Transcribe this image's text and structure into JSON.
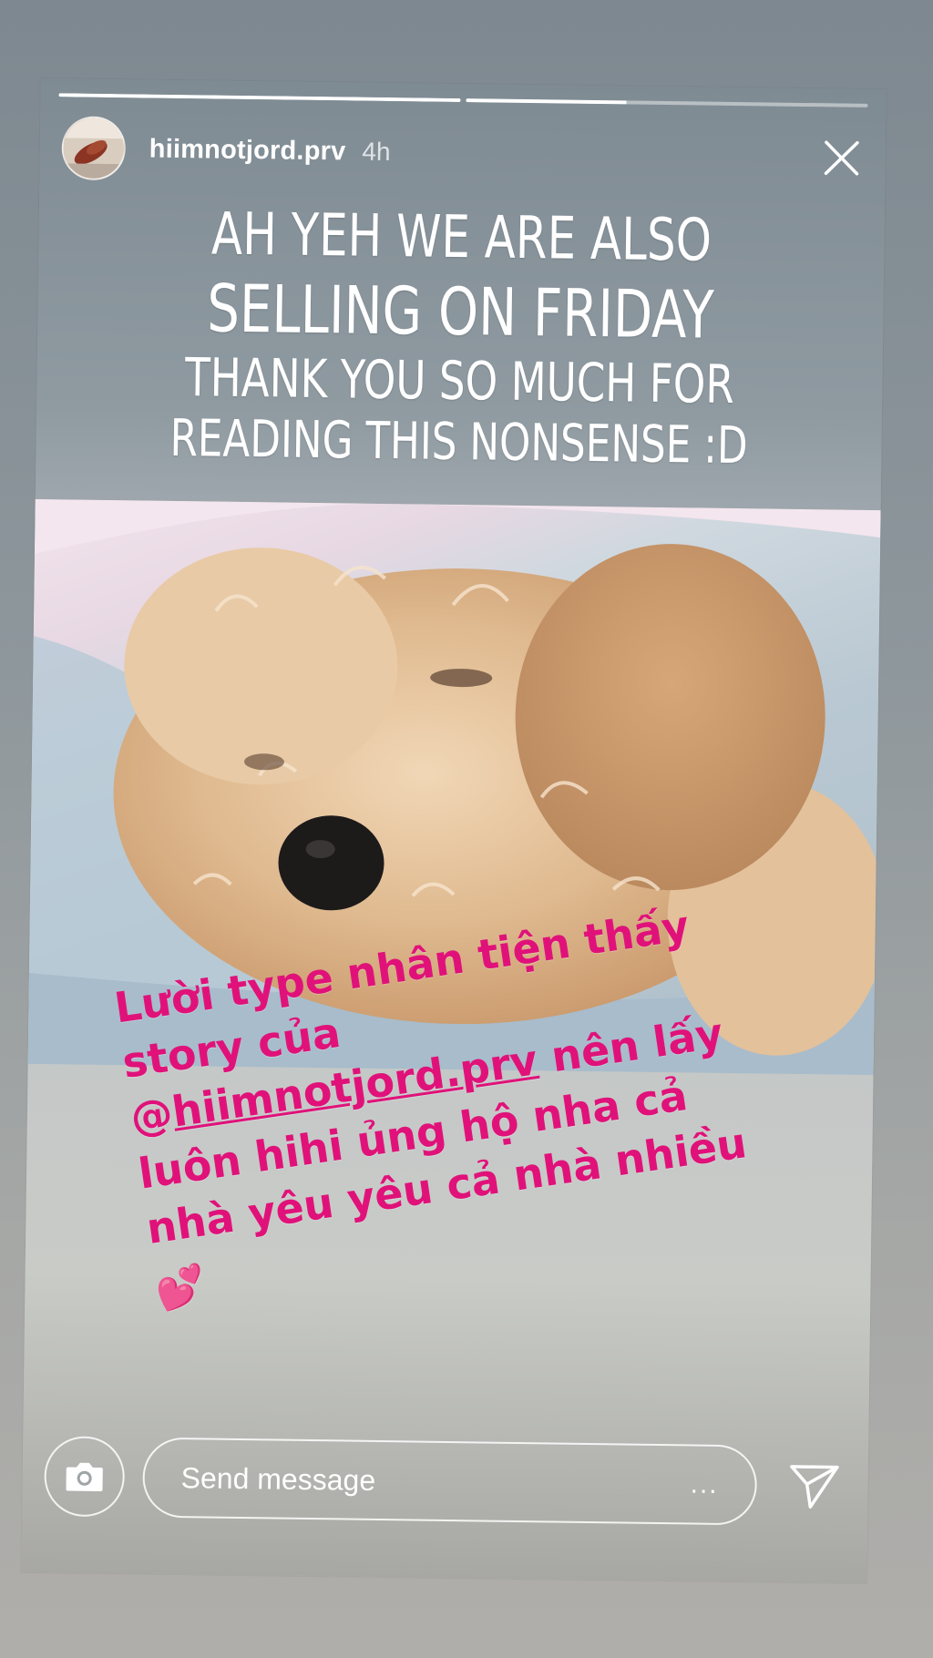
{
  "story": {
    "progress": [
      1.0,
      0.4
    ],
    "username": "hiimnotjord.prv",
    "time": "4h",
    "headline": [
      "AH YEH WE ARE ALSO",
      "SELLING ON FRIDAY",
      "THANK YOU SO MUCH FOR",
      "READING THIS NONSENSE :D"
    ],
    "caption": {
      "line1": "Lười type nhân tiện thấy",
      "line2": "story của",
      "at": "@",
      "mention": "hiimnotjord.prv",
      "line3_rest": " nên lấy",
      "line4": "luôn hihi ủng hộ nha cả",
      "line5": "nhà yêu yêu cả nhà nhiều",
      "emoji": "💕"
    },
    "colors": {
      "caption": "#e0127a",
      "text": "#ffffff"
    }
  },
  "reply": {
    "placeholder": "Send message",
    "more_label": "...",
    "camera_icon": "camera-icon",
    "send_icon": "send-icon"
  }
}
